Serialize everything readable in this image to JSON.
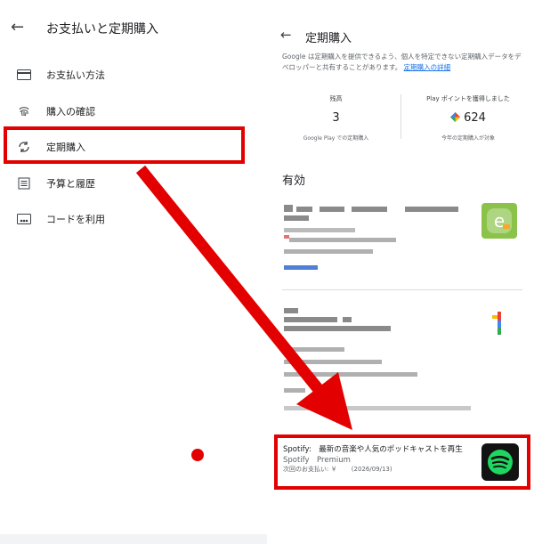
{
  "left_panel": {
    "back_icon": "arrow-back-icon",
    "title": "お支払いと定期購入",
    "items": [
      {
        "icon": "credit-card-icon",
        "label": "お支払い方法"
      },
      {
        "icon": "fingerprint-icon",
        "label": "購入の確認"
      },
      {
        "icon": "sync-icon",
        "label": "定期購入"
      },
      {
        "icon": "list-icon",
        "label": "予算と履歴"
      },
      {
        "icon": "code-icon",
        "label": "コードを利用"
      }
    ]
  },
  "right_panel": {
    "back_icon": "arrow-back-icon",
    "title": "定期購入",
    "description": "Google は定期購入を提供できるよう、個人を特定できない定期購入データをデベロッパーと共有することがあります。",
    "description_link": "定期購入の詳細",
    "stats": {
      "balance_caption": "残高",
      "balance_value": "3",
      "balance_sub": "Google Play での定期購入",
      "points_caption": "Play ポイントを獲得しました",
      "points_value": "624",
      "points_sub": "今年の定期購入が対象"
    },
    "section_title": "有効",
    "spotify": {
      "title": "Spotify:　最新の音楽や人気のポッドキャストを再生",
      "subtitle": "Spotify　Premium",
      "next_payment": "次回のお支払い: ￥　 　(2026/09/13)"
    }
  },
  "colors": {
    "highlight_red": "#e30000",
    "link_blue": "#1a73e8",
    "spotify_green": "#1ed760"
  }
}
